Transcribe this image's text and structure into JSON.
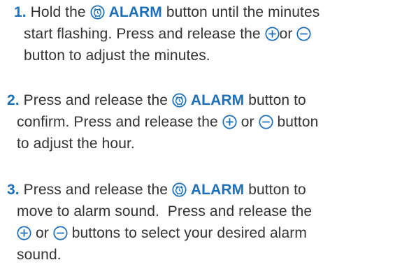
{
  "steps": [
    {
      "number": "1.",
      "lines": [
        {
          "pre": "Hold the",
          "alarm": "ALARM",
          "post": "button until the minutes"
        },
        {
          "pre": "start flashing. Press and release the",
          "mid": "or",
          "post": ""
        },
        {
          "text": "button to adjust the minutes."
        }
      ]
    },
    {
      "number": "2.",
      "lines": [
        {
          "pre": "Press and release the",
          "alarm": "ALARM",
          "post": "button to"
        },
        {
          "pre": "confirm. Press and release the",
          "mid": "or",
          "post": "button"
        },
        {
          "text": "to adjust the hour."
        }
      ]
    },
    {
      "number": "3.",
      "lines": [
        {
          "pre": "Press and release the",
          "alarm": "ALARM",
          "post": "button to"
        },
        {
          "text": "move to alarm sound.  Press and release the"
        },
        {
          "mid": "or",
          "post": "buttons to select your desired alarm"
        },
        {
          "text": "sound."
        }
      ]
    }
  ],
  "colors": {
    "accent": "#1d6fb8",
    "text": "#333333"
  },
  "icons": {
    "alarm": "alarm-clock-icon",
    "plus": "plus-circle-icon",
    "minus": "minus-circle-icon"
  }
}
